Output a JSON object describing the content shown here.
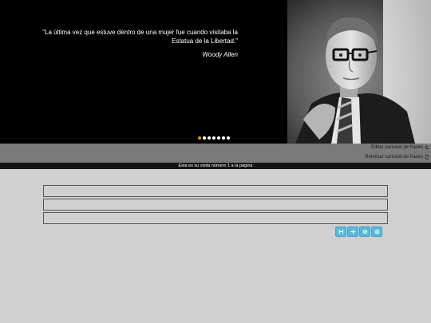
{
  "quote": {
    "text": "\"La última vez que estuve dentro de una mujer fue cuando visitaba la Estatua de la Libertad.\"",
    "author": "Woody Allen"
  },
  "carousel": {
    "dot_count": 7,
    "active_index": 0,
    "active_color": "#f08a1c",
    "dot_color": "#ffffff"
  },
  "controls": {
    "edit_label": "Editar carrusel de frases",
    "edit_icon": "refresh-icon",
    "reset_label": "Reiniciar carrusel de frases",
    "reset_icon": "sync-icon"
  },
  "visit_counter": {
    "text": "Esta es su visita número 1 a la página"
  },
  "fields": [
    {
      "value": "",
      "placeholder": ""
    },
    {
      "value": "",
      "placeholder": ""
    },
    {
      "value": "",
      "placeholder": ""
    }
  ],
  "buttons": [
    {
      "icon": "compress-icon"
    },
    {
      "icon": "plus-icon"
    },
    {
      "icon": "gear-icon"
    },
    {
      "icon": "target-icon"
    }
  ],
  "colors": {
    "background": "#d0d0d0",
    "banner": "#000000",
    "control_strip": "#7a7a7a",
    "visit_bar": "#141414",
    "button": "#5cb8d8"
  }
}
